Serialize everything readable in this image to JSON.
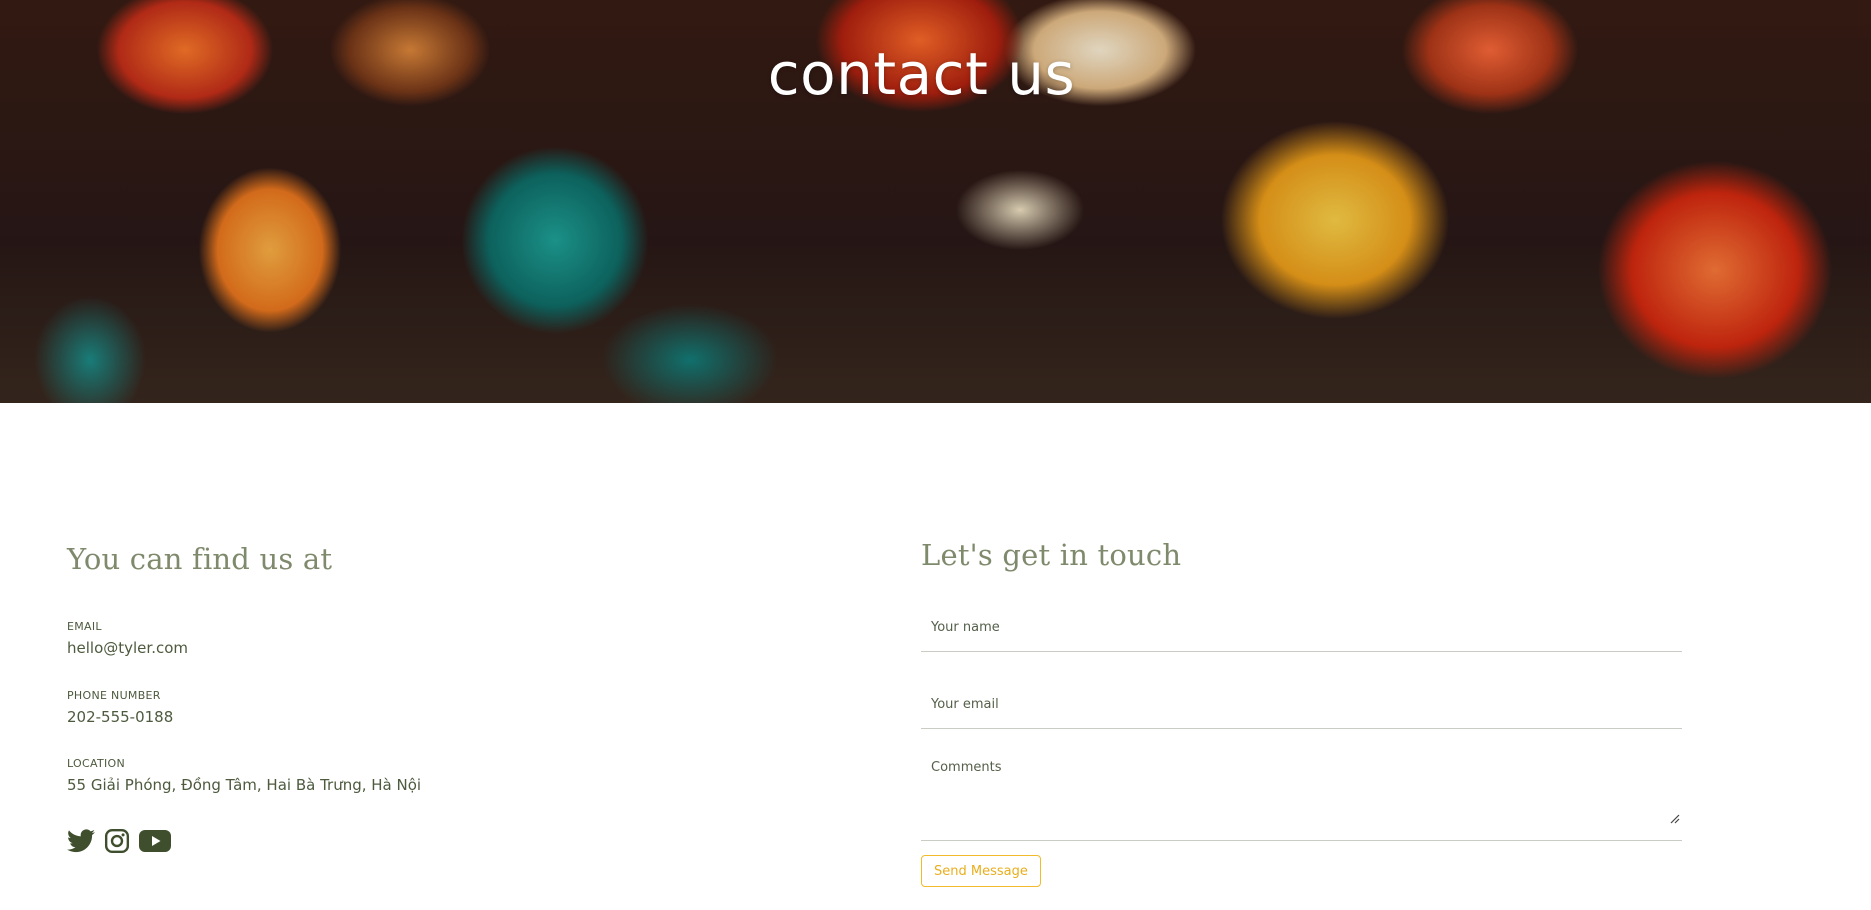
{
  "hero": {
    "title": "contact us"
  },
  "info": {
    "heading": "You can find us at",
    "email_label": "EMAIL",
    "email_value": "hello@tyler.com",
    "phone_label": "PHONE NUMBER",
    "phone_value": "202-555-0188",
    "location_label": "LOCATION",
    "location_value": "55 Giải Phóng, Đồng Tâm, Hai Bà Trưng, Hà Nội",
    "social_icons": [
      "twitter-icon",
      "instagram-icon",
      "youtube-icon"
    ]
  },
  "form": {
    "heading": "Let's get in touch",
    "name_placeholder": "Your name",
    "email_placeholder": "Your email",
    "comments_placeholder": "Comments",
    "submit_label": "Send Message"
  },
  "colors": {
    "accent": "#f2bb2c",
    "text": "#4d5a3e",
    "heading": "#7f8a6c"
  }
}
